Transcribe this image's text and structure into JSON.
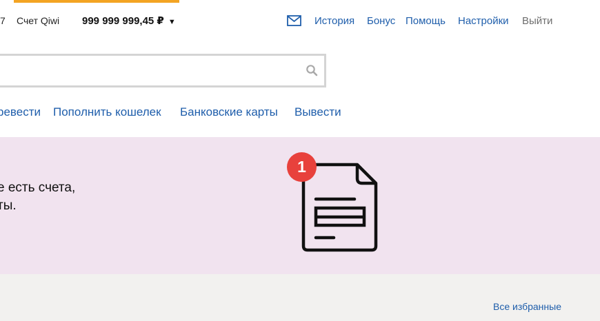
{
  "header": {
    "phone_tail": "7",
    "account_label": "Счет Qiwi",
    "balance": "999 999 999,45 ₽",
    "balance_caret": "▼",
    "nav": [
      {
        "label": "История"
      },
      {
        "label": "Бонус"
      },
      {
        "label": "Помощь"
      },
      {
        "label": "Настройки"
      },
      {
        "label": "Выйти"
      }
    ]
  },
  "search": {
    "value": "",
    "placeholder": ""
  },
  "main_nav": [
    {
      "label": "ревести"
    },
    {
      "label": "Пополнить кошелек"
    },
    {
      "label": "Банковские карты"
    },
    {
      "label": "Вывести"
    }
  ],
  "banner": {
    "line1": "е есть счета,",
    "line2": "ты.",
    "badge_count": "1"
  },
  "favorites": {
    "link_label": "Все избранные"
  },
  "colors": {
    "accent": "#f3a423",
    "link": "#1f5eab",
    "banner_bg": "#f1e3ef",
    "badge": "#e8413c",
    "grey_bg": "#f2f1ef"
  }
}
